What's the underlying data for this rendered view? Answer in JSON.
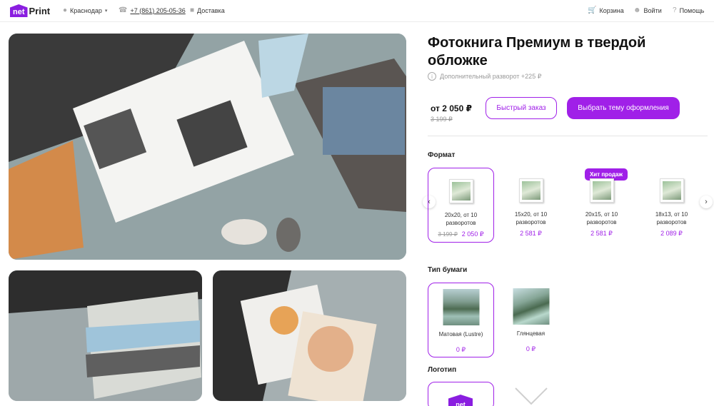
{
  "header": {
    "logo_badge": "net",
    "logo_text": "Print",
    "city": "Краснодар",
    "phone": "+7 (861) 205-05-36",
    "delivery": "Доставка",
    "cart": "Корзина",
    "login": "Войти",
    "help": "Помощь"
  },
  "product": {
    "title": "Фотокнига Премиум в твердой обложке",
    "note": "Дополнительный разворот +225 ₽",
    "price": "от 2 050 ₽",
    "old_price": "3 199 ₽",
    "quick_order": "Быстрый заказ",
    "choose_theme": "Выбрать тему оформления"
  },
  "format": {
    "title": "Формат",
    "badge": "Хит продаж",
    "items": [
      {
        "line1": "20x20, от 10",
        "line2": "разворотов",
        "old": "3 199 ₽",
        "price": "2 050 ₽"
      },
      {
        "line1": "15x20, от 10",
        "line2": "разворотов",
        "old": "",
        "price": "2 581 ₽"
      },
      {
        "line1": "20x15, от 10",
        "line2": "разворотов",
        "old": "",
        "price": "2 581 ₽"
      },
      {
        "line1": "18x13, от 10",
        "line2": "разворотов",
        "old": "",
        "price": "2 089 ₽"
      }
    ]
  },
  "paper": {
    "title": "Тип бумаги",
    "items": [
      {
        "label": "Матовая (Lustre)",
        "price": "0 ₽"
      },
      {
        "label": "Глянцевая",
        "price": "0 ₽"
      }
    ]
  },
  "logo_section": {
    "title": "Логотип",
    "logo_badge": "net"
  },
  "colors": {
    "accent": "#a020e8",
    "brand": "#8a1ee0"
  }
}
